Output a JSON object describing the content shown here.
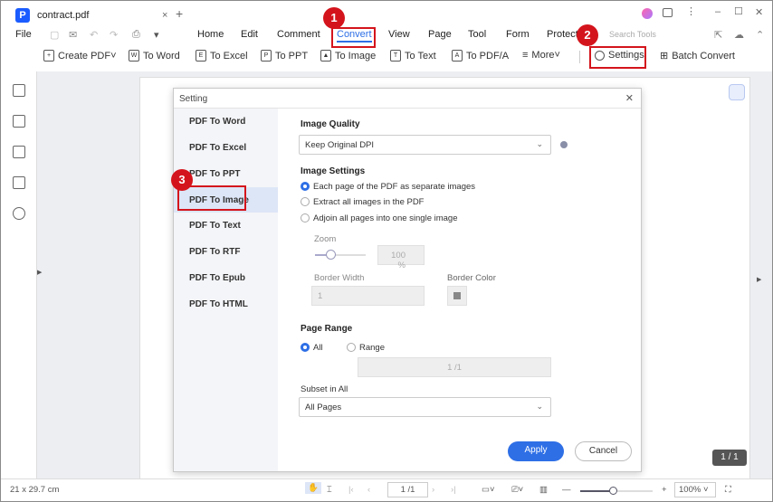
{
  "tab": {
    "title": "contract.pdf",
    "close": "×",
    "new": "+"
  },
  "window_controls": {
    "min": "–",
    "max": "☐",
    "close": "✕"
  },
  "menu": {
    "file": "File",
    "items": [
      "Home",
      "Edit",
      "Comment",
      "Convert",
      "View",
      "Page",
      "Tool",
      "Form",
      "Protect"
    ],
    "active": "Convert",
    "search_placeholder": "Search Tools"
  },
  "toolbar": {
    "items": [
      {
        "icon": "+",
        "label": "Create PDF˅"
      },
      {
        "icon": "W",
        "label": "To Word"
      },
      {
        "icon": "E",
        "label": "To Excel"
      },
      {
        "icon": "P",
        "label": "To PPT"
      },
      {
        "icon": "▲",
        "label": "To Image"
      },
      {
        "icon": "T",
        "label": "To Text"
      },
      {
        "icon": "A",
        "label": "To PDF/A"
      },
      {
        "icon": "≡",
        "label": "More˅"
      }
    ],
    "settings": "Settings",
    "batch": "Batch Convert"
  },
  "badges": [
    "1",
    "2",
    "3"
  ],
  "dialog": {
    "title": "Setting",
    "close": "✕",
    "nav": [
      "PDF To Word",
      "PDF To Excel",
      "PDF To PPT",
      "PDF To Image",
      "PDF To Text",
      "PDF To RTF",
      "PDF To Epub",
      "PDF To HTML"
    ],
    "active_nav": "PDF To Image",
    "image_quality_label": "Image Quality",
    "image_quality_value": "Keep Original DPI",
    "image_settings_label": "Image Settings",
    "image_options": [
      "Each page of the PDF as separate images",
      "Extract all images in the PDF",
      "Adjoin all pages into one single image"
    ],
    "zoom_label": "Zoom",
    "zoom_value": "100 %",
    "zoom_fraction": 0.3,
    "border_width_label": "Border Width",
    "border_width_value": "1",
    "border_color_label": "Border Color",
    "page_range_label": "Page Range",
    "range_all": "All",
    "range_custom": "Range",
    "range_value": "1 /1",
    "subset_label": "Subset in All",
    "subset_value": "All Pages",
    "apply": "Apply",
    "cancel": "Cancel"
  },
  "page_counter": "1 / 1",
  "status": {
    "size": "21 x 29.7 cm",
    "page": "1 /1",
    "zoom": "100%",
    "zoom_fraction": 0.45
  }
}
